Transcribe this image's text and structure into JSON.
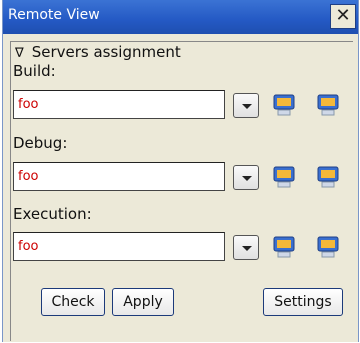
{
  "window": {
    "title": "Remote View",
    "close_label": "✕"
  },
  "section": {
    "toggle_glyph": "∇",
    "title": "Servers assignment"
  },
  "rows": [
    {
      "label": "Build:",
      "value": "foo"
    },
    {
      "label": "Debug:",
      "value": "foo"
    },
    {
      "label": "Execution:",
      "value": "foo"
    }
  ],
  "buttons": {
    "check": "Check",
    "apply": "Apply",
    "settings": "Settings"
  },
  "colors": {
    "titlebar": "#2459c4",
    "field_text": "#cc0000",
    "panel": "#ece9d8"
  },
  "icons": {
    "server_a": "monitor-server-icon",
    "server_b": "monitor-server-icon"
  }
}
